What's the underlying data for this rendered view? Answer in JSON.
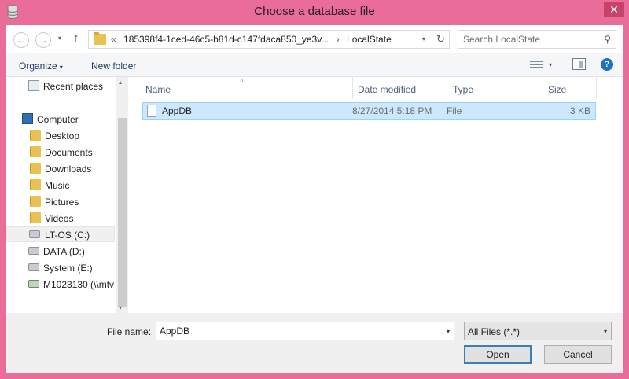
{
  "window": {
    "title": "Choose a database file",
    "close_glyph": "✕",
    "icon": "database-icon"
  },
  "nav": {
    "back_glyph": "←",
    "forward_glyph": "→",
    "up_glyph": "↑",
    "dropdown_glyph": "▾",
    "address": {
      "overflow": "«",
      "path": "185398f4-1ced-46c5-b81d-c147fdaca850_ye3v...",
      "separator": "›",
      "current": "LocalState",
      "dropdown_glyph": "▾",
      "refresh_glyph": "↻"
    },
    "search": {
      "placeholder": "Search LocalState",
      "icon_glyph": "⚲"
    }
  },
  "command_bar": {
    "organize_label": "Organize",
    "organize_caret": "▾",
    "new_folder_label": "New folder",
    "view_caret": "▾",
    "help_glyph": "?"
  },
  "navigation_pane": {
    "items": [
      {
        "label": "Recent places",
        "icon": "recent-places-icon"
      },
      {
        "label": "Computer",
        "icon": "computer-icon"
      },
      {
        "label": "Desktop",
        "icon": "folder-icon"
      },
      {
        "label": "Documents",
        "icon": "folder-icon"
      },
      {
        "label": "Downloads",
        "icon": "folder-icon"
      },
      {
        "label": "Music",
        "icon": "folder-icon"
      },
      {
        "label": "Pictures",
        "icon": "folder-icon"
      },
      {
        "label": "Videos",
        "icon": "folder-icon"
      },
      {
        "label": "LT-OS (C:)",
        "icon": "drive-icon",
        "selected": true
      },
      {
        "label": "DATA (D:)",
        "icon": "drive-icon"
      },
      {
        "label": "System (E:)",
        "icon": "drive-icon"
      },
      {
        "label": "M1023130 (\\\\mtv",
        "icon": "network-drive-icon"
      }
    ],
    "scroll_up_glyph": "▴",
    "scroll_down_glyph": "▾"
  },
  "file_list": {
    "sort_glyph": "˄",
    "columns": [
      "Name",
      "Date modified",
      "Type",
      "Size"
    ],
    "rows": [
      {
        "name": "AppDB",
        "date_modified": "8/27/2014 5:18 PM",
        "type": "File",
        "size": "3 KB",
        "selected": true
      }
    ]
  },
  "footer": {
    "file_name_label": "File name:",
    "file_name_value": "AppDB",
    "file_name_caret": "▾",
    "file_type_value": "All Files (*.*)",
    "file_type_caret": "▾",
    "open_label": "Open",
    "cancel_label": "Cancel"
  },
  "colors": {
    "titlebar": "#e96d98",
    "selection": "#cce8ff",
    "selection_border": "#99d1ff",
    "primary_button_border": "#3c7fb1"
  }
}
